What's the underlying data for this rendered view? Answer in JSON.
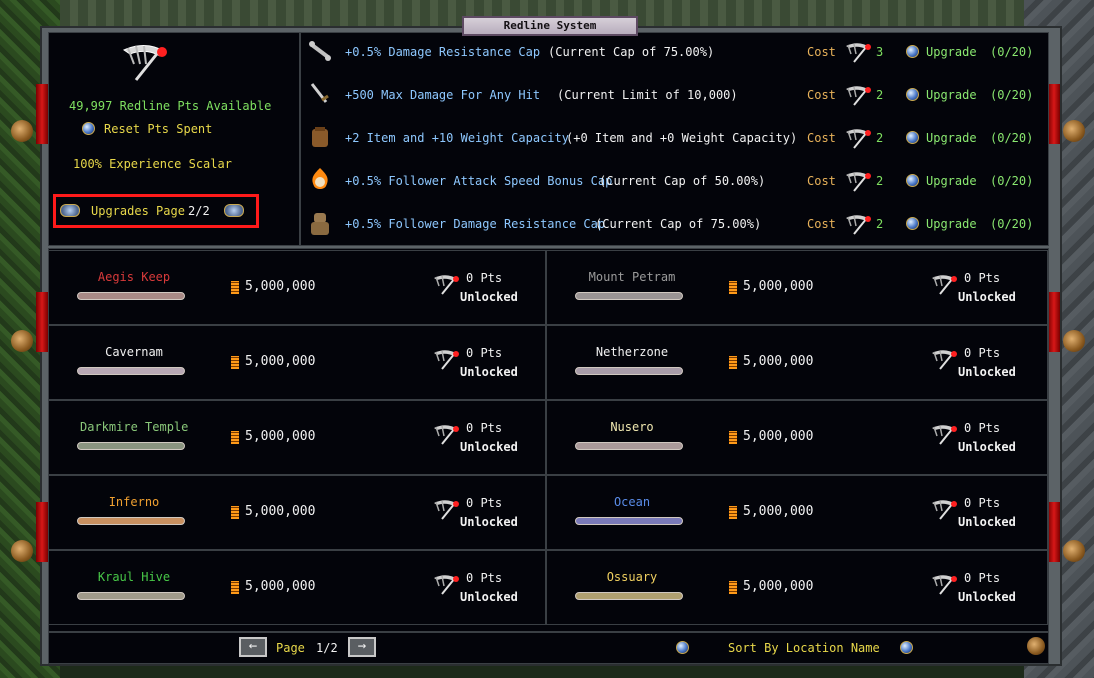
{
  "window": {
    "title": "Redline System"
  },
  "summary": {
    "points_available": "49,997 Redline Pts Available",
    "reset_label": "Reset Pts Spent",
    "experience_scalar": "100% Experience Scalar",
    "upgrades_page_label": "Upgrades Page",
    "upgrades_page_value": "2/2"
  },
  "upgrades": [
    {
      "icon": "bone-icon",
      "name": "+0.5% Damage Resistance Cap",
      "detail": "(Current Cap of 75.00%)",
      "cost_label": "Cost",
      "cost": "3",
      "action": "Upgrade",
      "progress": "(0/20)"
    },
    {
      "icon": "dagger-icon",
      "name": "+500 Max Damage For Any Hit",
      "detail": "(Current Limit of 10,000)",
      "cost_label": "Cost",
      "cost": "2",
      "action": "Upgrade",
      "progress": "(0/20)"
    },
    {
      "icon": "backpack-icon",
      "name": "+2 Item and +10 Weight Capacity",
      "detail": "(+0 Item and +0 Weight Capacity)",
      "cost_label": "Cost",
      "cost": "2",
      "action": "Upgrade",
      "progress": "(0/20)"
    },
    {
      "icon": "flame-skull-icon",
      "name": "+0.5% Follower Attack Speed Bonus Cap",
      "detail": "(Current Cap of 50.00%)",
      "cost_label": "Cost",
      "cost": "2",
      "action": "Upgrade",
      "progress": "(0/20)"
    },
    {
      "icon": "golem-icon",
      "name": "+0.5% Follower Damage Resistance Cap",
      "detail": "(Current Cap of 75.00%)",
      "cost_label": "Cost",
      "cost": "2",
      "action": "Upgrade",
      "progress": "(0/20)"
    }
  ],
  "locations": [
    {
      "name": "Aegis Keep",
      "name_color": "#d83a3a",
      "bar_color": "#a88a86",
      "gold": "5,000,000",
      "pts": "0 Pts",
      "status": "Unlocked"
    },
    {
      "name": "Mount Petram",
      "name_color": "#9a9a9a",
      "bar_color": "#9a9494",
      "gold": "5,000,000",
      "pts": "0 Pts",
      "status": "Unlocked"
    },
    {
      "name": "Cavernam",
      "name_color": "#f2f2f2",
      "bar_color": "#b8a8b4",
      "gold": "5,000,000",
      "pts": "0 Pts",
      "status": "Unlocked"
    },
    {
      "name": "Netherzone",
      "name_color": "#f2f2f2",
      "bar_color": "#a89ca8",
      "gold": "5,000,000",
      "pts": "0 Pts",
      "status": "Unlocked"
    },
    {
      "name": "Darkmire Temple",
      "name_color": "#8ac87a",
      "bar_color": "#8a9480",
      "gold": "5,000,000",
      "pts": "0 Pts",
      "status": "Unlocked"
    },
    {
      "name": "Nusero",
      "name_color": "#f0e8b0",
      "bar_color": "#aa9a9a",
      "gold": "5,000,000",
      "pts": "0 Pts",
      "status": "Unlocked"
    },
    {
      "name": "Inferno",
      "name_color": "#f0a030",
      "bar_color": "#c89060",
      "gold": "5,000,000",
      "pts": "0 Pts",
      "status": "Unlocked"
    },
    {
      "name": "Ocean",
      "name_color": "#5a8ce8",
      "bar_color": "#7a7ab8",
      "gold": "5,000,000",
      "pts": "0 Pts",
      "status": "Unlocked"
    },
    {
      "name": "Kraul Hive",
      "name_color": "#48c848",
      "bar_color": "#a09a8a",
      "gold": "5,000,000",
      "pts": "0 Pts",
      "status": "Unlocked"
    },
    {
      "name": "Ossuary",
      "name_color": "#f0d060",
      "bar_color": "#b0a070",
      "gold": "5,000,000",
      "pts": "0 Pts",
      "status": "Unlocked"
    }
  ],
  "footer": {
    "page_label": "Page",
    "page_value": "1/2",
    "sort_label": "Sort By Location Name"
  },
  "colors": {
    "accent_red": "#ff1a1a",
    "panel_bg": "#03040a",
    "frame": "#5c6367"
  }
}
